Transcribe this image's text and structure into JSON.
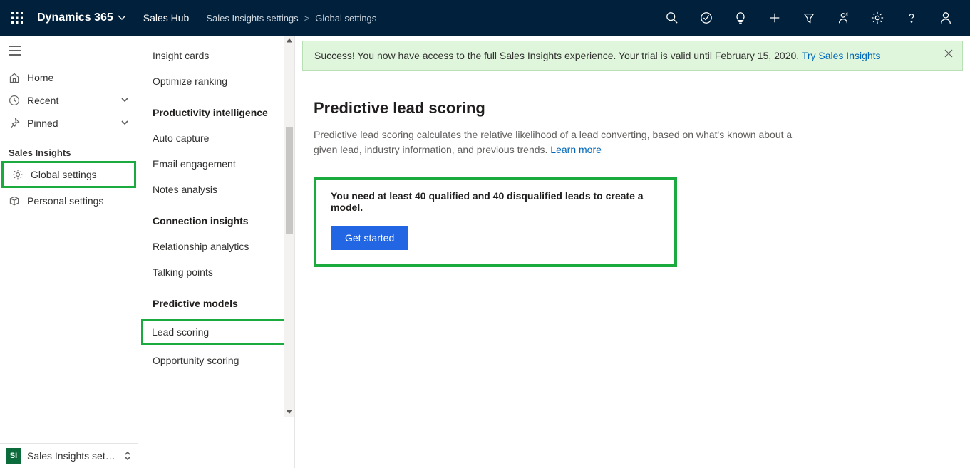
{
  "topbar": {
    "brand": "Dynamics 365",
    "hub": "Sales Hub",
    "breadcrumb": {
      "parent": "Sales Insights settings",
      "current": "Global settings"
    }
  },
  "leftnav": {
    "items": {
      "home": "Home",
      "recent": "Recent",
      "pinned": "Pinned"
    },
    "section_header": "Sales Insights",
    "section_items": {
      "global": "Global settings",
      "personal": "Personal settings"
    },
    "footer": {
      "badge": "SI",
      "label": "Sales Insights sett…"
    }
  },
  "midnav": {
    "top_items": {
      "insight_cards": "Insight cards",
      "optimize_ranking": "Optimize ranking"
    },
    "groups": {
      "productivity": {
        "heading": "Productivity intelligence",
        "items": {
          "auto_capture": "Auto capture",
          "email_engagement": "Email engagement",
          "notes_analysis": "Notes analysis"
        }
      },
      "connection": {
        "heading": "Connection insights",
        "items": {
          "relationship_analytics": "Relationship analytics",
          "talking_points": "Talking points"
        }
      },
      "predictive": {
        "heading": "Predictive models",
        "items": {
          "lead_scoring": "Lead scoring",
          "opportunity_scoring": "Opportunity scoring"
        }
      }
    }
  },
  "banner": {
    "text": "Success! You now have access to the full Sales Insights experience. Your trial is valid until February 15, 2020. ",
    "link": "Try Sales Insights"
  },
  "content": {
    "heading": "Predictive lead scoring",
    "lead_text": "Predictive lead scoring calculates the relative likelihood of a lead converting, based on what's known about a given lead, industry information, and previous trends. ",
    "learn_more": "Learn more",
    "cta": {
      "requirement": "You need at least 40 qualified and 40 disqualified leads to create a model.",
      "button": "Get started"
    }
  }
}
